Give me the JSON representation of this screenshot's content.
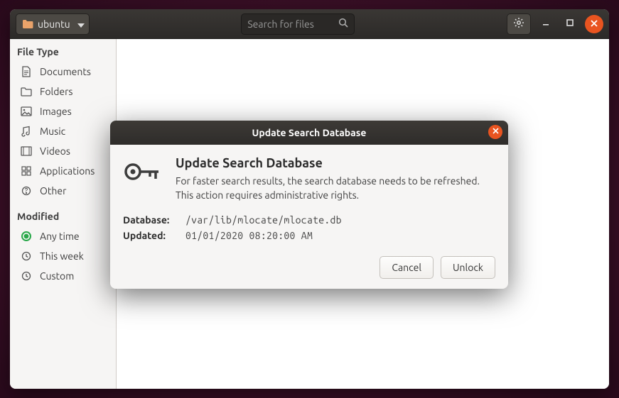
{
  "header": {
    "path_label": "ubuntu",
    "search_placeholder": "Search for files"
  },
  "sidebar": {
    "section_filetype": "File Type",
    "items": [
      {
        "icon": "document",
        "label": "Documents"
      },
      {
        "icon": "folder",
        "label": "Folders"
      },
      {
        "icon": "image",
        "label": "Images"
      },
      {
        "icon": "music",
        "label": "Music"
      },
      {
        "icon": "video",
        "label": "Videos"
      },
      {
        "icon": "app",
        "label": "Applications"
      },
      {
        "icon": "other",
        "label": "Other"
      }
    ],
    "section_modified": "Modified",
    "modified": [
      {
        "label": "Any time",
        "selected": true
      },
      {
        "label": "This week",
        "selected": false
      },
      {
        "label": "Custom",
        "selected": false
      }
    ]
  },
  "dialog": {
    "title": "Update Search Database",
    "heading": "Update Search Database",
    "message": "For faster search results, the search database needs to be refreshed. This action requires administrative rights.",
    "rows": {
      "database_label": "Database:",
      "database_value": "/var/lib/mlocate/mlocate.db",
      "updated_label": "Updated:",
      "updated_value": "01/01/2020 08:20:00 AM"
    },
    "cancel": "Cancel",
    "unlock": "Unlock"
  }
}
